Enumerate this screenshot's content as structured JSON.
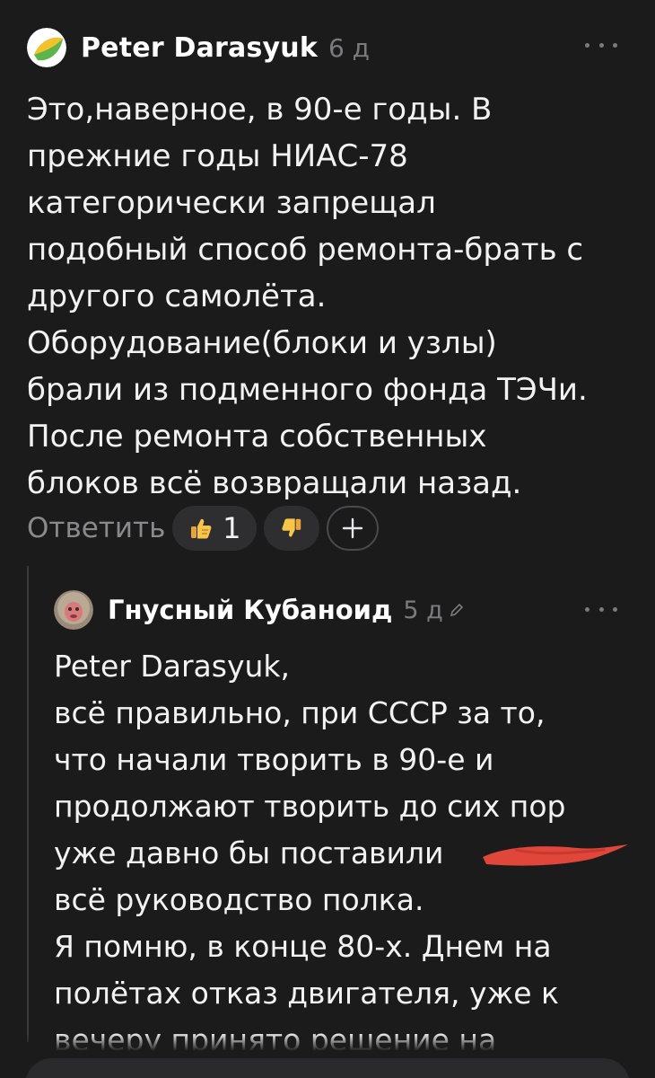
{
  "comment1": {
    "author": "Peter Darasyuk",
    "time": "6 д",
    "lines": [
      "Это,наверное, в 90-е годы. В",
      "прежние годы НИАС-78",
      "категорически запрещал",
      "подобный способ ремонта-брать с",
      "другого самолёта.",
      "Оборудование(блоки и узлы)",
      "брали из подменного фонда ТЭЧи.",
      "После ремонта собственных",
      "блоков всё возвращали назад."
    ],
    "reply_label": "Ответить",
    "like_count": "1",
    "add_symbol": "+"
  },
  "comment2": {
    "author": "Гнусный Кубаноид",
    "time": "5 д",
    "lines": [
      "Peter Darasyuk,",
      "всё правильно, при СССР за то,",
      "что начали творить в 90-е и",
      "продолжают творить до сих пор",
      "уже давно бы поставили",
      "всё руководство полка.",
      "Я помню, в конце 80-х.  Днем на",
      "полётах отказ двигателя, уже к",
      "вечеру принято решение на"
    ]
  },
  "colors": {
    "background": "#1b1b1c",
    "text": "#f2f2f2",
    "muted": "#7b7b7e",
    "pill": "#2e2e30",
    "redaction": "#e0463a"
  },
  "icons": {
    "comment1_avatar": "avatar-leaf-icon",
    "like": "thumbs-up-icon",
    "dislike": "thumbs-down-icon",
    "add_reaction": "plus-icon",
    "more": "more-dots-icon",
    "edited": "pencil-icon"
  }
}
